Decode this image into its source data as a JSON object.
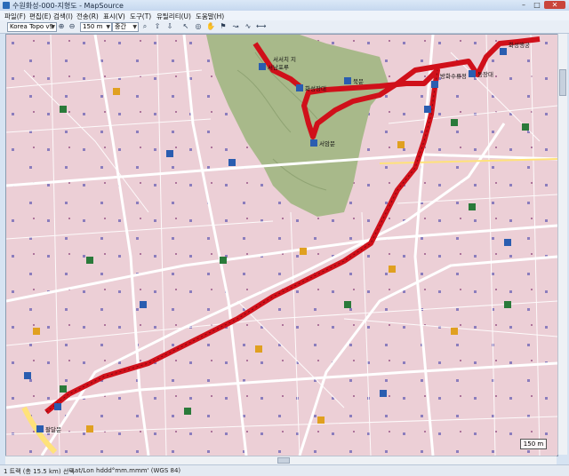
{
  "window": {
    "title": "수원화성-000-지형도 - MapSource",
    "min_label": "–",
    "max_label": "□",
    "close_label": "✕"
  },
  "menu": [
    {
      "label": "파일(F)"
    },
    {
      "label": "편집(E)"
    },
    {
      "label": "검색(I)"
    },
    {
      "label": "전송(R)"
    },
    {
      "label": "표시(V)"
    },
    {
      "label": "도구(T)"
    },
    {
      "label": "유틸리티(U)"
    },
    {
      "label": "도움말(H)"
    }
  ],
  "toolbar": {
    "map_product": "Korea Topo v9",
    "zoom_value": "150 m",
    "detail_level": "중간",
    "icons": [
      "zoom-in-icon",
      "zoom-out-icon",
      "find-icon",
      "gps-send-icon",
      "gps-receive-icon",
      "select-tool-icon",
      "zoom-tool-icon",
      "pan-tool-icon",
      "waypoint-tool-icon",
      "route-tool-icon",
      "track-tool-icon",
      "distance-tool-icon"
    ]
  },
  "map": {
    "scale_label": "150 m",
    "waypoints": [
      {
        "label": "서남포루",
        "icon": "hiker-icon"
      },
      {
        "label": "서서치 지",
        "icon": "hiker-icon"
      },
      {
        "label": "화성장대",
        "icon": "hiker-icon"
      },
      {
        "label": "서암문",
        "icon": "hiker-icon"
      },
      {
        "label": "북문",
        "icon": "hiker-icon"
      },
      {
        "label": "방화수류정",
        "icon": "hiker-icon"
      },
      {
        "label": "동장대",
        "icon": "hiker-icon"
      },
      {
        "label": "화성행궁",
        "icon": "hiker-icon"
      },
      {
        "label": "팔달문",
        "icon": "hiker-icon"
      }
    ],
    "track_color": "#d0101a",
    "road_color": "#ffffff",
    "park_color": "#a8b98a"
  },
  "status": {
    "track_summary": "1 트랙 (총 15.5 km) 선택",
    "coord_format": "Lat/Lon hddd°mm.mmm' (WGS 84)"
  }
}
